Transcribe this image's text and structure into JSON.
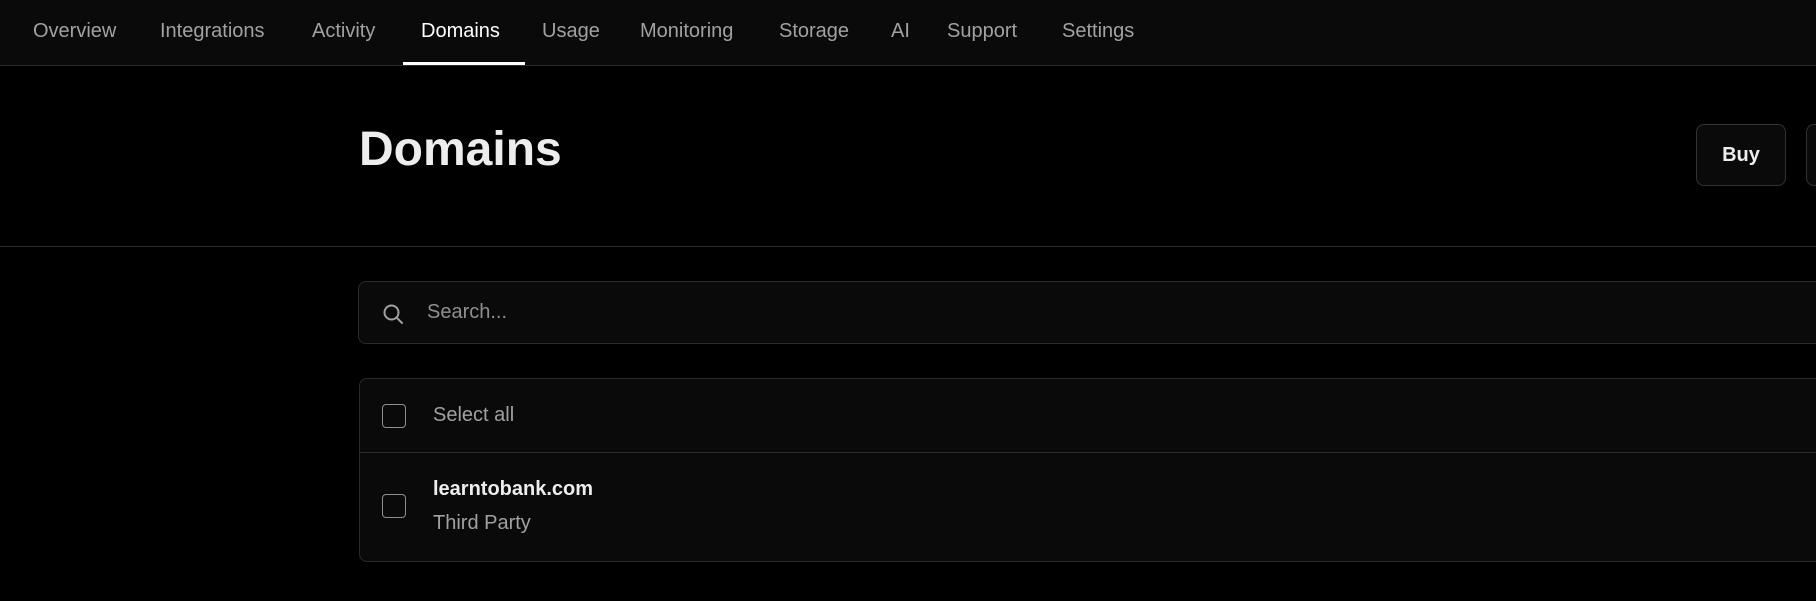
{
  "nav": {
    "tabs": [
      {
        "label": "Overview"
      },
      {
        "label": "Integrations"
      },
      {
        "label": "Activity"
      },
      {
        "label": "Domains",
        "active": true
      },
      {
        "label": "Usage"
      },
      {
        "label": "Monitoring"
      },
      {
        "label": "Storage"
      },
      {
        "label": "AI"
      },
      {
        "label": "Support"
      },
      {
        "label": "Settings"
      }
    ]
  },
  "header": {
    "title": "Domains",
    "buy_label": "Buy"
  },
  "search": {
    "placeholder": "Search..."
  },
  "list": {
    "select_all_label": "Select all",
    "rows": [
      {
        "domain": "learntobank.com",
        "type": "Third Party"
      }
    ]
  },
  "colors": {
    "background": "#000000",
    "surface": "#0a0a0a",
    "border": "#2a2a2a",
    "text_primary": "#ededed",
    "text_secondary": "#a1a1a1"
  }
}
